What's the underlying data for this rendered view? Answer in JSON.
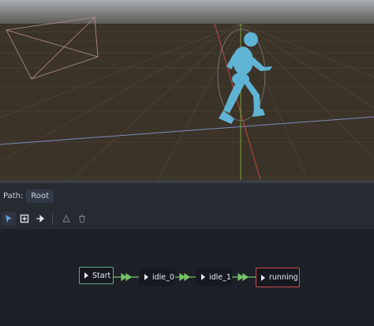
{
  "path": {
    "label": "Path:",
    "root": "Root"
  },
  "toolbar": {
    "tools": [
      {
        "icon": "select-cursor-icon",
        "active": true
      },
      {
        "icon": "create-node-icon",
        "active": false
      },
      {
        "icon": "connect-transition-icon",
        "active": false
      },
      {
        "icon": "auto-triangle-icon",
        "active": false
      },
      {
        "icon": "trash-icon",
        "active": false
      }
    ]
  },
  "state_machine": {
    "nodes": [
      {
        "id": "start",
        "label": "Start"
      },
      {
        "id": "idle_0",
        "label": "idle_0"
      },
      {
        "id": "idle_1",
        "label": "idle_1"
      },
      {
        "id": "running",
        "label": "running"
      }
    ]
  },
  "colors": {
    "start_border": "#5fa88f",
    "current_border": "#d04a4a",
    "transition": "#78c06a",
    "character": "#5fb3d4"
  }
}
